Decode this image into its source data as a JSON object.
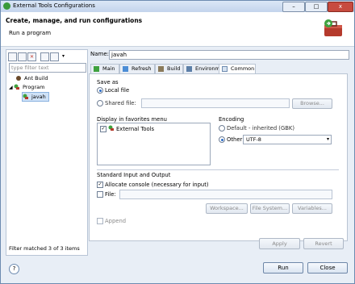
{
  "window": {
    "title": "External Tools Configurations",
    "buttons": {
      "minimize": "–",
      "maximize": "□",
      "close": "x"
    }
  },
  "header": {
    "title": "Create, manage, and run configurations",
    "subtitle": "Run a program"
  },
  "left_panel": {
    "filter_placeholder": "type filter text",
    "tree": [
      {
        "label": "Ant Build",
        "icon": "ant-icon"
      },
      {
        "label": "Program",
        "icon": "program-icon"
      },
      {
        "label": "javah",
        "icon": "external-tool-icon"
      }
    ],
    "footer": "Filter matched 3 of 3 items"
  },
  "right_panel": {
    "name_label": "Name:",
    "name_value": "javah",
    "tabs": [
      {
        "label": "Main"
      },
      {
        "label": "Refresh"
      },
      {
        "label": "Build"
      },
      {
        "label": "Environment"
      },
      {
        "label": "Common"
      }
    ],
    "save_as": {
      "title": "Save as",
      "local_file": "Local file",
      "shared_file": "Shared file:",
      "browse": "Browse..."
    },
    "favorites": {
      "title": "Display in favorites menu",
      "item": "External Tools"
    },
    "encoding": {
      "title": "Encoding",
      "default": "Default - inherited (GBK)",
      "other": "Other",
      "value": "UTF-8"
    },
    "stdio": {
      "title": "Standard Input and Output",
      "allocate_console": "Allocate console (necessary for input)",
      "file": "File:",
      "workspace": "Workspace...",
      "file_system": "File System...",
      "variables": "Variables...",
      "append": "Append"
    },
    "apply": "Apply",
    "revert": "Revert"
  },
  "bottom": {
    "help": "?",
    "run": "Run",
    "close": "Close"
  }
}
